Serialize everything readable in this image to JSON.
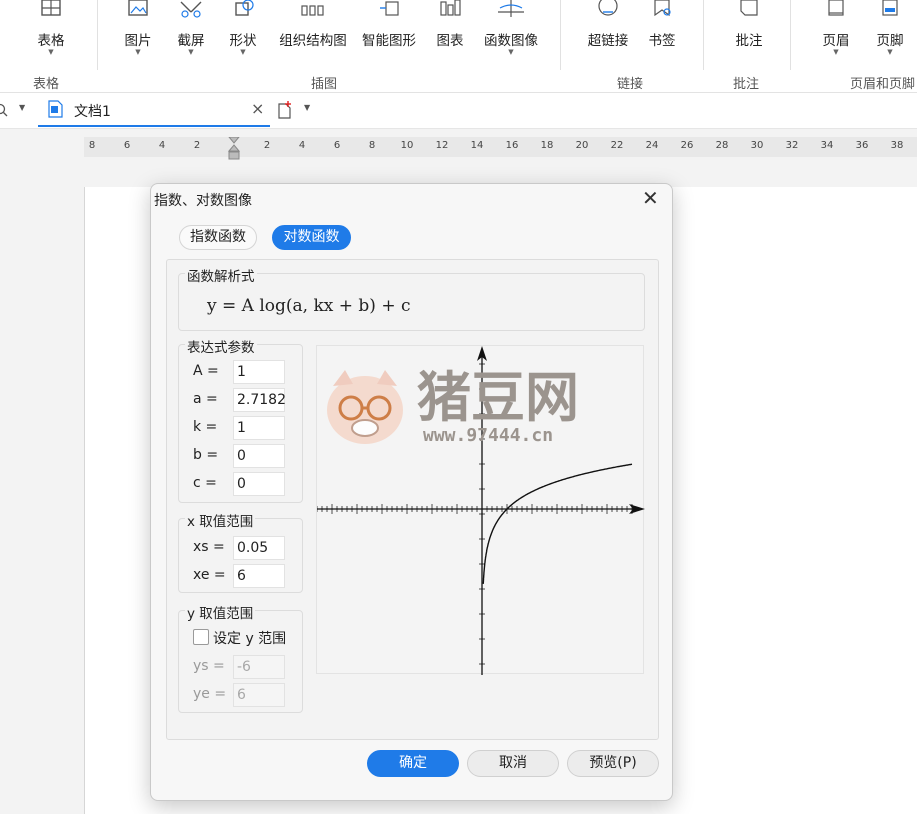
{
  "ribbon": {
    "tools": [
      {
        "label": "表格",
        "icon": "table-icon",
        "caret": true
      },
      {
        "label": "图片",
        "icon": "picture-icon",
        "caret": true
      },
      {
        "label": "截屏",
        "icon": "screenshot-icon",
        "caret": true
      },
      {
        "label": "形状",
        "icon": "shape-icon",
        "caret": true
      },
      {
        "label": "组织结构图",
        "icon": "org-chart-icon",
        "caret": false
      },
      {
        "label": "智能图形",
        "icon": "smart-graphic-icon",
        "caret": false
      },
      {
        "label": "图表",
        "icon": "chart-icon",
        "caret": false
      },
      {
        "label": "函数图像",
        "icon": "function-graph-icon",
        "caret": true
      },
      {
        "label": "超链接",
        "icon": "hyperlink-icon",
        "caret": false
      },
      {
        "label": "书签",
        "icon": "bookmark-icon",
        "caret": false
      },
      {
        "label": "批注",
        "icon": "comment-icon",
        "caret": false
      },
      {
        "label": "页眉",
        "icon": "header-icon",
        "caret": true
      },
      {
        "label": "页脚",
        "icon": "footer-icon",
        "caret": true
      }
    ],
    "groups": [
      "表格",
      "插图",
      "链接",
      "批注",
      "页眉和页脚"
    ]
  },
  "tabbar": {
    "doc_name": "文档1",
    "close_glyph": "×"
  },
  "ruler": {
    "ticks": [
      "8",
      "6",
      "4",
      "2",
      "2",
      "4",
      "6",
      "8",
      "10",
      "12",
      "14",
      "16",
      "18",
      "20",
      "22",
      "24",
      "26",
      "28",
      "30",
      "32",
      "34",
      "36",
      "38"
    ]
  },
  "dialog": {
    "title": "指数、对数图像",
    "close_glyph": "✕",
    "tabs": {
      "exponential": "指数函数",
      "logarithmic": "对数函数",
      "active": "logarithmic"
    },
    "formula_legend": "函数解析式",
    "formula": "y = A  log(a, kx + b) + c",
    "params_legend": "表达式参数",
    "params": [
      {
        "label": "A =",
        "value": "1"
      },
      {
        "label": "a =",
        "value": "2.7182"
      },
      {
        "label": "k =",
        "value": "1"
      },
      {
        "label": "b =",
        "value": "0"
      },
      {
        "label": "c =",
        "value": "0"
      }
    ],
    "x_range_legend": "x 取值范围",
    "x_range": [
      {
        "label": "xs =",
        "value": "0.05"
      },
      {
        "label": "xe =",
        "value": "6"
      }
    ],
    "y_range_legend": "y 取值范围",
    "y_range_checkbox_label": "设定 y 范围",
    "y_range_checked": false,
    "y_range": [
      {
        "label": "ys =",
        "value": "-6"
      },
      {
        "label": "ye =",
        "value": "6"
      }
    ],
    "buttons": {
      "ok": "确定",
      "cancel": "取消",
      "preview": "预览(P)"
    }
  },
  "watermark": {
    "logo_text": "猪豆网",
    "url": "www.97444.cn"
  },
  "colors": {
    "accent": "#1f7be8",
    "watermark": "#9b948e"
  }
}
